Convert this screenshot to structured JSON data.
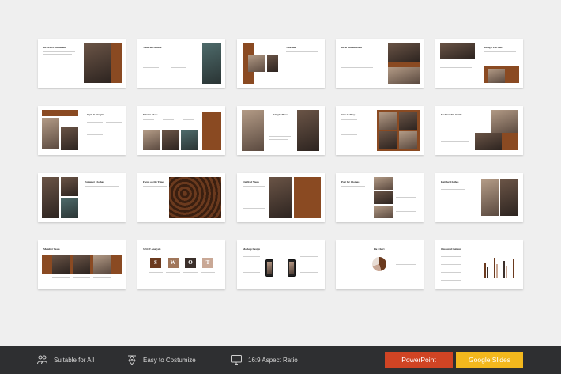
{
  "slides": [
    {
      "title": "Brown Presentation"
    },
    {
      "title": "Table of Content"
    },
    {
      "title": "Welcome"
    },
    {
      "title": "Brief Introduction"
    },
    {
      "title": "Design The Store"
    },
    {
      "title": "Style & Simple"
    },
    {
      "title": "Winter Shots"
    },
    {
      "title": "Simple Piece"
    },
    {
      "title": "Our Gallery"
    },
    {
      "title": "Fashionable Outfit"
    },
    {
      "title": "Summer Clothes"
    },
    {
      "title": "Focus on the Time"
    },
    {
      "title": "Outfit of Week"
    },
    {
      "title": "Pair for Clothes"
    },
    {
      "title": "Pair for Clothes"
    },
    {
      "title": "Member Team"
    },
    {
      "title": "SWOT Analysis"
    },
    {
      "title": "Mockup Design"
    },
    {
      "title": "Pie Chart"
    },
    {
      "title": "Clustered Column"
    }
  ],
  "swot_letters": [
    "S",
    "W",
    "O",
    "T"
  ],
  "footer": {
    "features": [
      {
        "label": "Suitable for All",
        "icon": "people-icon"
      },
      {
        "label": "Easy to Costumize",
        "icon": "pen-tool-icon"
      },
      {
        "label": "16:9 Aspect Ratio",
        "icon": "monitor-icon"
      }
    ],
    "powerpoint_label": "PowerPoint",
    "google_slides_label": "Google Slides"
  },
  "colors": {
    "brand_brown": "#8a4a22",
    "powerpoint_red": "#d04424",
    "google_yellow": "#f3b81d",
    "footer_bg": "#2e2f31",
    "page_bg": "#efefef"
  }
}
